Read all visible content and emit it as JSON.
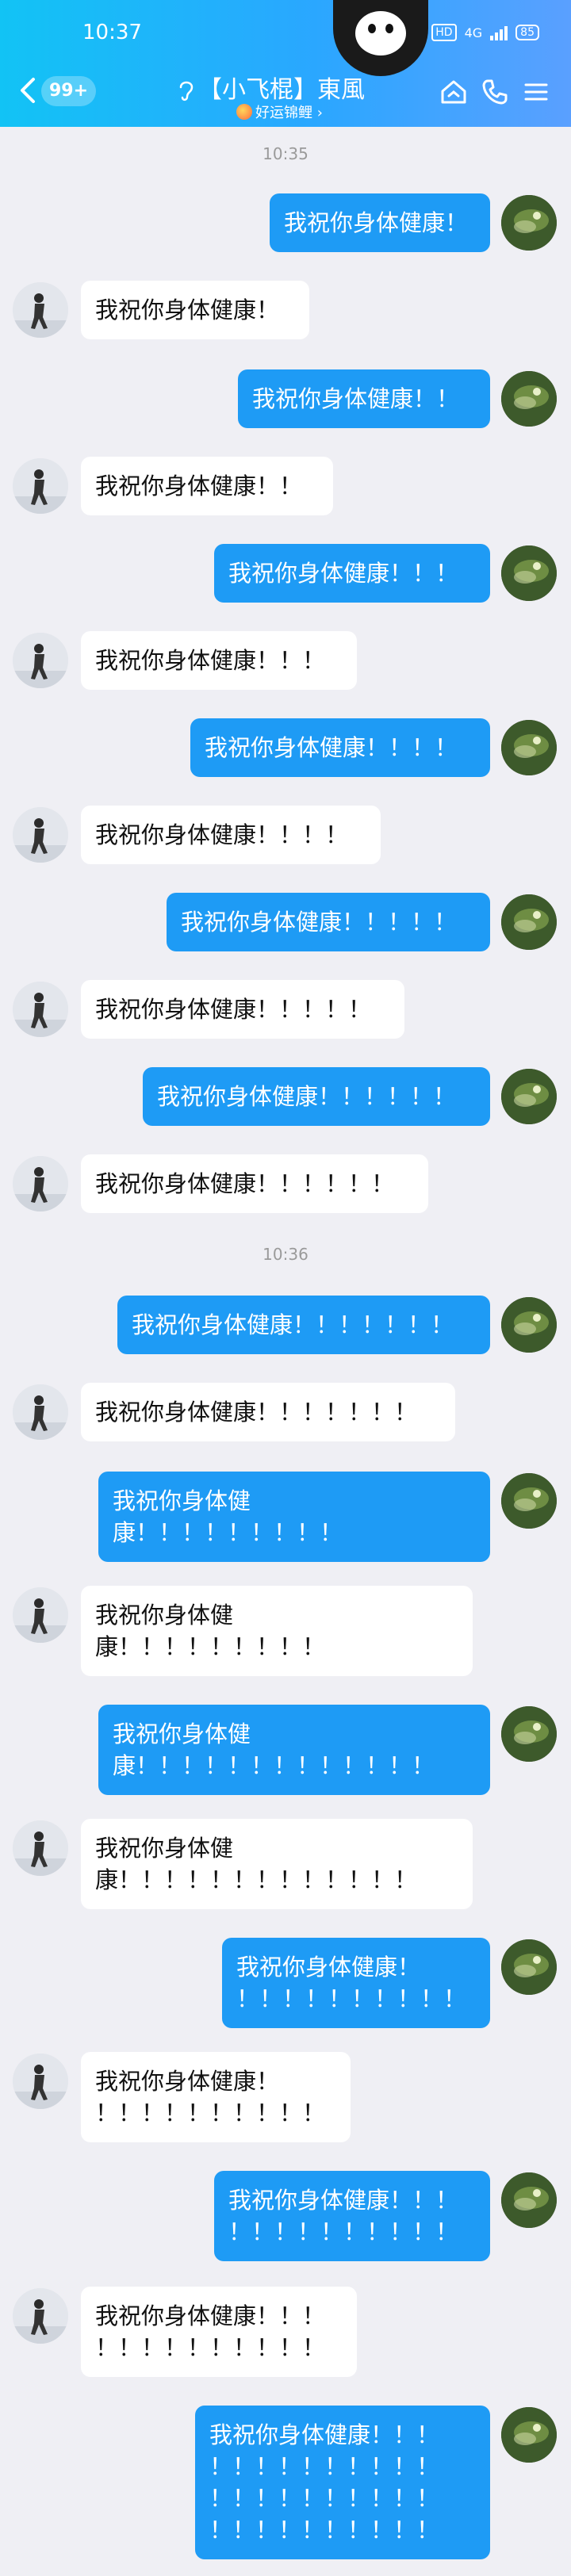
{
  "status_bar": {
    "time": "10:37",
    "hd": "HD",
    "network": "4G",
    "battery": "85"
  },
  "header": {
    "unread_count": "99+",
    "title": "【小飞棍】東風",
    "subtitle": "好运锦鲤 ›"
  },
  "icons": {
    "back": "chevron-left-icon",
    "ear": "ear-icon",
    "home": "home-icon",
    "phone": "phone-icon",
    "menu": "menu-icon",
    "koi": "koi-icon"
  },
  "colors": {
    "header_start": "#12c3f5",
    "header_end": "#5aa0ff",
    "sent_bubble": "#1e9bf5",
    "received_bubble": "#ffffff",
    "background": "#efeff4"
  },
  "timestamps": [
    "10:35",
    "10:36"
  ],
  "messages": [
    {
      "side": "right",
      "text": "我祝你身体健康！"
    },
    {
      "side": "left",
      "text": "我祝你身体健康！"
    },
    {
      "side": "right",
      "text": "我祝你身体健康！！"
    },
    {
      "side": "left",
      "text": "我祝你身体健康！！"
    },
    {
      "side": "right",
      "text": "我祝你身体健康！！！"
    },
    {
      "side": "left",
      "text": "我祝你身体健康！！！"
    },
    {
      "side": "right",
      "text": "我祝你身体健康！！！！"
    },
    {
      "side": "left",
      "text": "我祝你身体健康！！！！"
    },
    {
      "side": "right",
      "text": "我祝你身体健康！！！！！"
    },
    {
      "side": "left",
      "text": "我祝你身体健康！！！！！"
    },
    {
      "side": "right",
      "text": "我祝你身体健康！！！！！！"
    },
    {
      "side": "left",
      "text": "我祝你身体健康！！！！！！"
    },
    {
      "side": "right",
      "text": "我祝你身体健康！！！！！！！"
    },
    {
      "side": "left",
      "text": "我祝你身体健康！！！！！！！"
    },
    {
      "side": "right",
      "text": "我祝你身体健\n康！！！！！！！！！"
    },
    {
      "side": "left",
      "text": "我祝你身体健\n康！！！！！！！！！"
    },
    {
      "side": "right",
      "text": "我祝你身体健\n康！！！！！！！！！！！！！"
    },
    {
      "side": "left",
      "text": "我祝你身体健\n康！！！！！！！！！！！！！"
    },
    {
      "side": "right",
      "text": "我祝你身体健康！\n！！！！！！！！！！"
    },
    {
      "side": "left",
      "text": "我祝你身体健康！\n！！！！！！！！！！"
    },
    {
      "side": "right",
      "text": "我祝你身体健康！！！\n！！！！！！！！！！"
    },
    {
      "side": "left",
      "text": "我祝你身体健康！！！\n！！！！！！！！！！"
    },
    {
      "side": "right",
      "text": "我祝你身体健康！！！\n！！！！！！！！！！\n！！！！！！！！！！\n！！！！！！！！！！"
    }
  ]
}
